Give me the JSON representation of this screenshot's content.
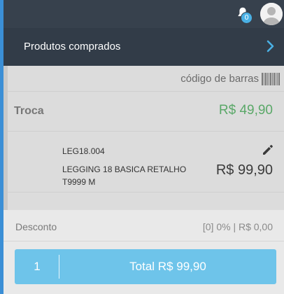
{
  "header": {
    "notifications_count": "0"
  },
  "section": {
    "title": "Produtos comprados"
  },
  "barcode": {
    "label": "código de barras"
  },
  "troca": {
    "label": "Troca",
    "value": "R$ 49,90"
  },
  "item": {
    "code": "LEG18.004",
    "description": "LEGGING 18 BASICA RETALHO T9999 M",
    "price": "R$ 99,90"
  },
  "desconto": {
    "label": "Desconto",
    "value": "[0] 0% | R$ 0,00"
  },
  "total_button": {
    "quantity": "1",
    "label": "Total R$ 99,90"
  },
  "icons": {
    "bell": "bell-icon",
    "avatar": "user-avatar-icon",
    "chevron": "chevron-right-icon",
    "barcode": "barcode-icon",
    "edit": "pencil-icon"
  },
  "colors": {
    "header_bg": "#37414d",
    "section_bg": "#323c48",
    "accent_left": "#3b8fd6",
    "badge": "#4ab0e4",
    "troca_value": "#5aa868",
    "total_button": "#6ec4ea"
  }
}
